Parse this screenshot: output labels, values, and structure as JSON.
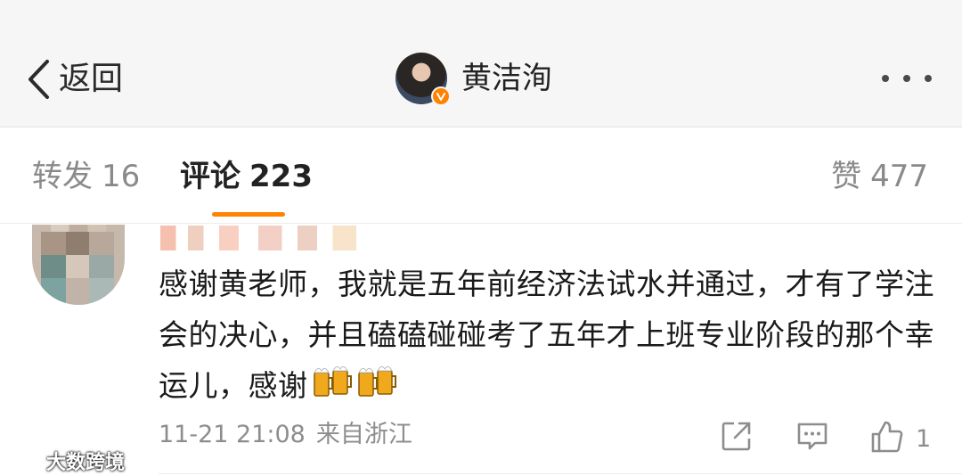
{
  "header": {
    "back_label": "返回",
    "profile_name": "黄洁洵"
  },
  "tabs": {
    "repost_label": "转发",
    "repost_count": "16",
    "comments_label": "评论",
    "comments_count": "223",
    "likes_label": "赞",
    "likes_count": "477",
    "active": "comments"
  },
  "comment": {
    "text": "感谢黄老师，我就是五年前经济法试水并通过，才有了学注会的决心，并且磕磕碰碰考了五年才上班专业阶段的那个幸运儿，感谢",
    "emoji": [
      "beer-mugs",
      "beer-mugs"
    ],
    "timestamp": "11-21 21:08",
    "source": "来自浙江",
    "like_count": "1"
  },
  "watermark": {
    "text": "大数跨境"
  },
  "colors": {
    "accent": "#ff8200",
    "header_bg": "#f6f6f6",
    "meta_gray": "#8d8d8d"
  }
}
